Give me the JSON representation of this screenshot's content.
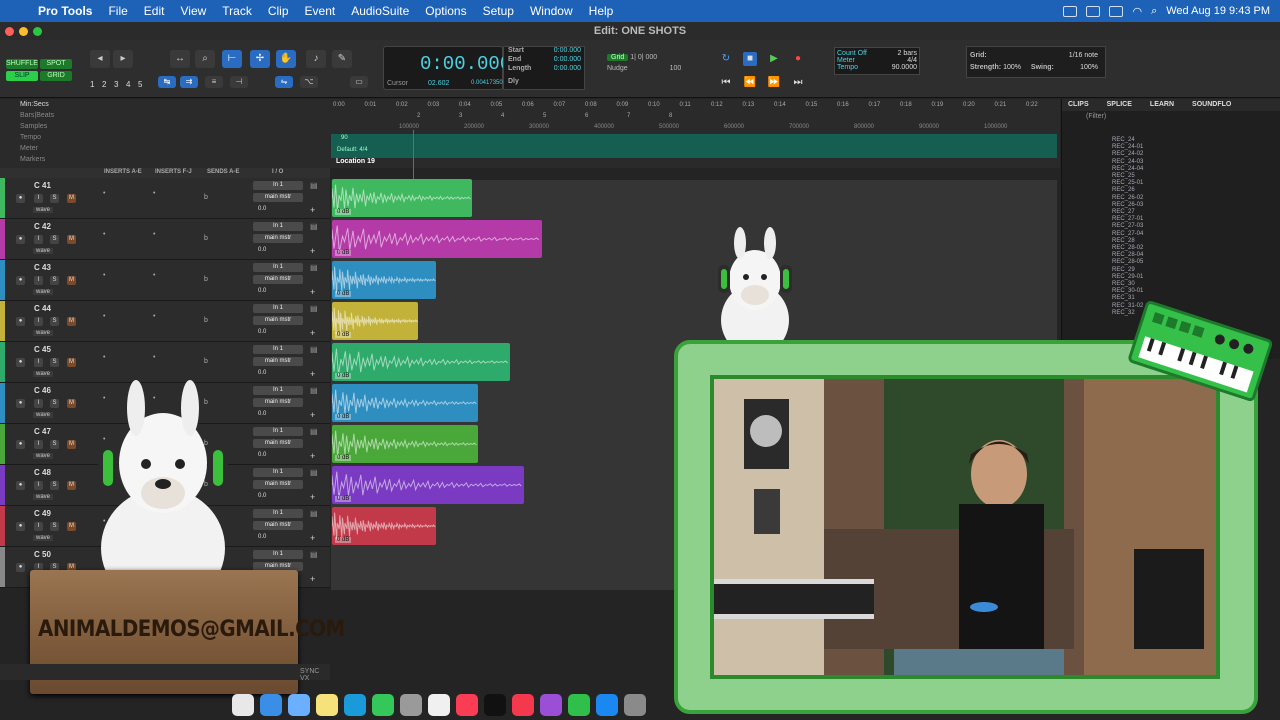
{
  "menubar": {
    "apple": "",
    "app": "Pro Tools",
    "items": [
      "File",
      "Edit",
      "View",
      "Track",
      "Clip",
      "Event",
      "AudioSuite",
      "Options",
      "Setup",
      "Window",
      "Help"
    ],
    "datetime": "Wed Aug 19  9:43 PM"
  },
  "window": {
    "title": "Edit: ONE SHOTS"
  },
  "modes": {
    "shuffle": "SHUFFLE",
    "spot": "SPOT",
    "slip": "SLIP",
    "grid": "GRID"
  },
  "zoom_presets": [
    "1",
    "2",
    "3",
    "4",
    "5"
  ],
  "counter": {
    "main": "0:00.000",
    "cursor_label": "Cursor",
    "cursor_value": "02.602",
    "samples": "0.004173503"
  },
  "selection": {
    "start_label": "Start",
    "start": "0:00.000",
    "end_label": "End",
    "end": "0:00.000",
    "length_label": "Length",
    "length": "0:00.000",
    "dly": "Dly"
  },
  "grid_nudge": {
    "grid_label": "Grid",
    "grid_value": "1| 0| 000",
    "nudge_label": "Nudge",
    "nudge_value": "100"
  },
  "tempo": {
    "count_off": "Count Off",
    "meter": "Meter",
    "tempo": "Tempo",
    "bars": "2 bars",
    "meter_val": "4/4",
    "tempo_val": "90.0000"
  },
  "gridpanel": {
    "grid": "Grid:",
    "note": "1/16 note",
    "strength": "Strength:",
    "strength_val": "100%",
    "swing": "Swing:",
    "swing_val": "100%"
  },
  "rulers": {
    "labels": [
      "Min:Secs",
      "Bars|Beats",
      "Samples",
      "Tempo",
      "Meter",
      "Markers"
    ],
    "min_ticks": [
      "0:00",
      "0:01",
      "0:02",
      "0:03",
      "0:04",
      "0:05",
      "0:06",
      "0:07",
      "0:08",
      "0:09",
      "0:10",
      "0:11",
      "0:12",
      "0:13",
      "0:14",
      "0:15",
      "0:16",
      "0:17",
      "0:18",
      "0:19",
      "0:20",
      "0:21",
      "0:22"
    ],
    "sample_ticks": [
      "100000",
      "200000",
      "300000",
      "400000",
      "500000",
      "600000",
      "700000",
      "800000",
      "900000",
      "1000000"
    ],
    "bar_ticks": [
      "2",
      "3",
      "4",
      "5",
      "6",
      "7",
      "8"
    ],
    "tempo_val": "90",
    "meter_val": "Default: 4/4",
    "marker": "Location 19"
  },
  "edit_header": {
    "inserts_ae": "INSERTS A-E",
    "inserts_fj": "INSERTS F-J",
    "sends_ae": "SENDS A-E",
    "io": "I / O"
  },
  "tracks": [
    {
      "name": "C 41",
      "color": "#3fb860",
      "in": "In 1",
      "out": "main mstr",
      "vol": "0.0"
    },
    {
      "name": "C 42",
      "color": "#b43aa8",
      "in": "In 1",
      "out": "main mstr",
      "vol": "0.0"
    },
    {
      "name": "C 43",
      "color": "#2f8ec0",
      "in": "In 1",
      "out": "main mstr",
      "vol": "0.0"
    },
    {
      "name": "C 44",
      "color": "#c2b23a",
      "in": "In 1",
      "out": "main mstr",
      "vol": "0.0"
    },
    {
      "name": "C 45",
      "color": "#2eaa6a",
      "in": "In 1",
      "out": "main mstr",
      "vol": "0.0"
    },
    {
      "name": "C 46",
      "color": "#2f8ec0",
      "in": "In 1",
      "out": "main mstr",
      "vol": "0.0"
    },
    {
      "name": "C 47",
      "color": "#4aa83a",
      "in": "In 1",
      "out": "main mstr",
      "vol": "0.0"
    },
    {
      "name": "C 48",
      "color": "#7a3ac2",
      "in": "In 1",
      "out": "main mstr",
      "vol": "0.0"
    },
    {
      "name": "C 49",
      "color": "#c23a4a",
      "in": "In 1",
      "out": "main mstr",
      "vol": "0.0"
    },
    {
      "name": "C 50",
      "color": "#888888",
      "in": "In 1",
      "out": "main mstr",
      "vol": ""
    }
  ],
  "track_buttons": {
    "solo": "S",
    "mute": "M",
    "input": "I",
    "wave": "wave"
  },
  "clip_gain": "0 dB",
  "right_panel": {
    "tabs": [
      "CLIPS",
      "SPLICE",
      "LEARN",
      "SOUNDFLO"
    ],
    "filter": "(Filter)",
    "items": [
      "REC_24",
      "REC_24-01",
      "REC_24-02",
      "REC_24-03",
      "REC_24-04",
      "REC_25",
      "REC_25-01",
      "REC_26",
      "REC_26-02",
      "REC_26-03",
      "REC_27",
      "REC_27-01",
      "REC_27-03",
      "REC_27-04",
      "REC_28",
      "REC_28-02",
      "REC_28-04",
      "REC_28-05",
      "REC_29",
      "REC_29-01",
      "REC_30",
      "REC_30-01",
      "REC_31",
      "REC_31-02",
      "REC_32"
    ]
  },
  "overlay": {
    "sign_text": "ANIMALDEMOS@GMAIL.COM"
  },
  "bottombar": {
    "sync": "SYNC VX"
  },
  "colors": {
    "accent": "#1e62b7",
    "cam_frame": "#3aa23a"
  }
}
